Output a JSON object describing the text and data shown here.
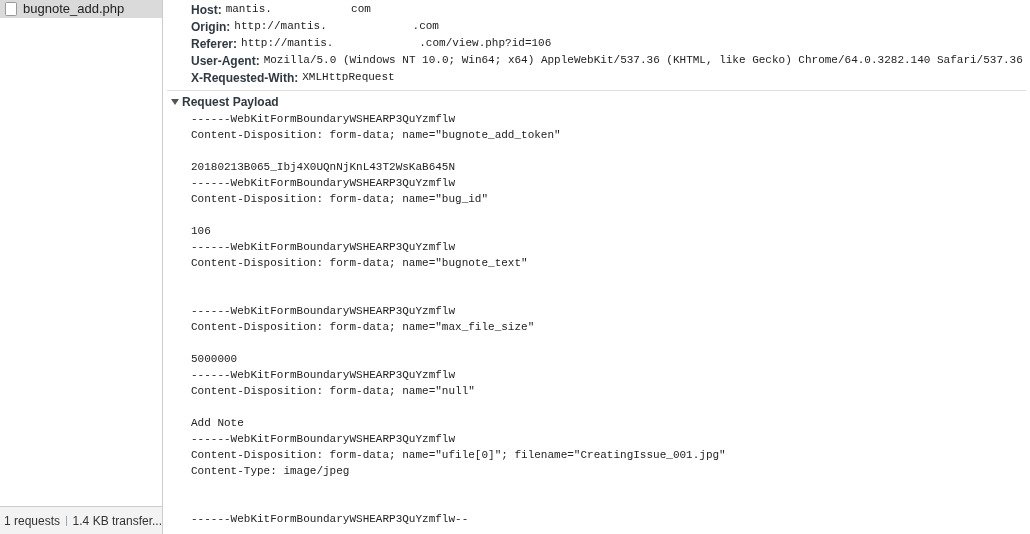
{
  "sidebar": {
    "items": [
      {
        "name": "bugnote_add.php",
        "selected": true
      }
    ]
  },
  "status_bar": {
    "requests": "1 requests",
    "transferred": "1.4 KB transfer..."
  },
  "headers": [
    {
      "name": "Host:",
      "value": "mantis.            com"
    },
    {
      "name": "Origin:",
      "value": "http://mantis.             .com"
    },
    {
      "name": "Referer:",
      "value": "http://mantis.             .com/view.php?id=106"
    },
    {
      "name": "User-Agent:",
      "value": "Mozilla/5.0 (Windows NT 10.0; Win64; x64) AppleWebKit/537.36 (KHTML, like Gecko) Chrome/64.0.3282.140 Safari/537.36"
    },
    {
      "name": "X-Requested-With:",
      "value": "XMLHttpRequest"
    }
  ],
  "payload": {
    "title": "Request Payload",
    "expanded": true,
    "lines": [
      {
        "kind": "text",
        "text": "------WebKitFormBoundaryWSHEARP3QuYzmflw"
      },
      {
        "kind": "text",
        "text": "Content-Disposition: form-data; name=\"bugnote_add_token\""
      },
      {
        "kind": "blank"
      },
      {
        "kind": "text",
        "text": "20180213B065_Ibj4X0UQnNjKnL43T2WsKaB645N"
      },
      {
        "kind": "text",
        "text": "------WebKitFormBoundaryWSHEARP3QuYzmflw"
      },
      {
        "kind": "text",
        "text": "Content-Disposition: form-data; name=\"bug_id\""
      },
      {
        "kind": "blank"
      },
      {
        "kind": "text",
        "text": "106"
      },
      {
        "kind": "text",
        "text": "------WebKitFormBoundaryWSHEARP3QuYzmflw"
      },
      {
        "kind": "text",
        "text": "Content-Disposition: form-data; name=\"bugnote_text\""
      },
      {
        "kind": "blank"
      },
      {
        "kind": "blank"
      },
      {
        "kind": "text",
        "text": "------WebKitFormBoundaryWSHEARP3QuYzmflw"
      },
      {
        "kind": "text",
        "text": "Content-Disposition: form-data; name=\"max_file_size\""
      },
      {
        "kind": "blank"
      },
      {
        "kind": "text",
        "text": "5000000"
      },
      {
        "kind": "text",
        "text": "------WebKitFormBoundaryWSHEARP3QuYzmflw"
      },
      {
        "kind": "text",
        "text": "Content-Disposition: form-data; name=\"null\""
      },
      {
        "kind": "blank"
      },
      {
        "kind": "text",
        "text": "Add Note"
      },
      {
        "kind": "text",
        "text": "------WebKitFormBoundaryWSHEARP3QuYzmflw"
      },
      {
        "kind": "text",
        "text": "Content-Disposition: form-data; name=\"ufile[0]\"; filename=\"CreatingIssue_001.jpg\""
      },
      {
        "kind": "text",
        "text": "Content-Type: image/jpeg"
      },
      {
        "kind": "blank"
      },
      {
        "kind": "blank"
      },
      {
        "kind": "text",
        "text": "------WebKitFormBoundaryWSHEARP3QuYzmflw--"
      }
    ]
  }
}
